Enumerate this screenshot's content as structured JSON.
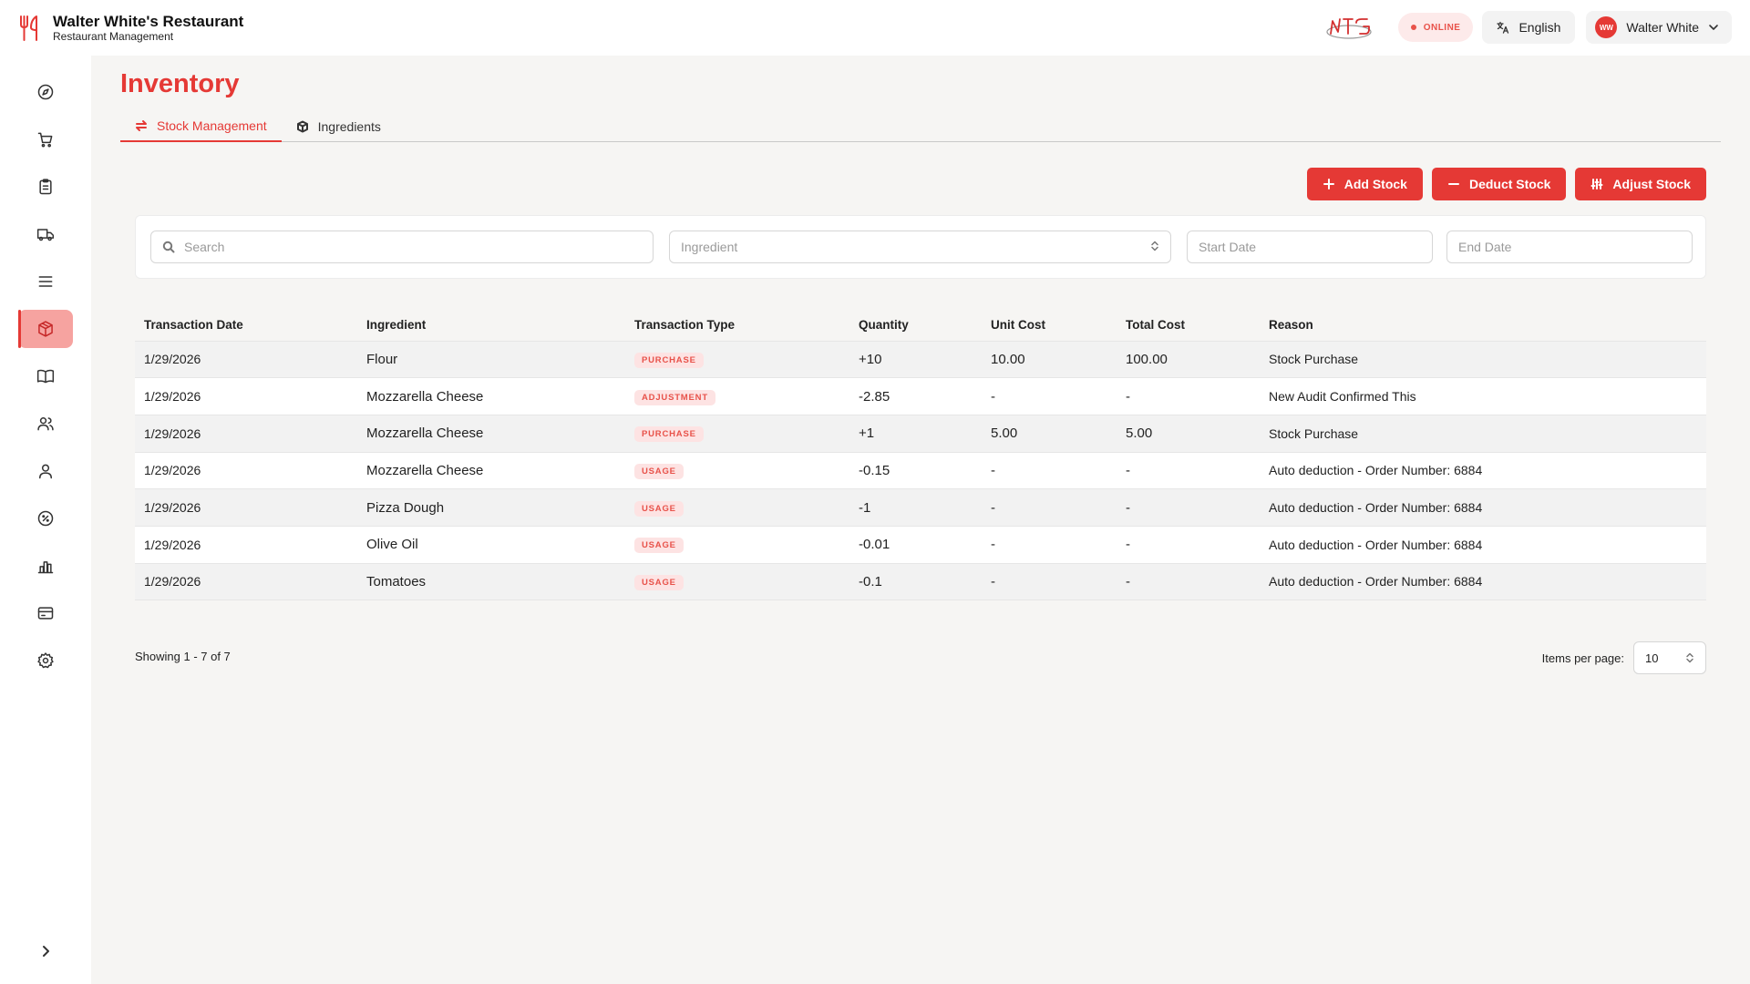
{
  "header": {
    "title": "Walter White's Restaurant",
    "subtitle": "Restaurant Management",
    "status": "ONLINE",
    "language": "English",
    "user_initials": "WW",
    "user_name": "Walter White"
  },
  "sidebar": {
    "items": [
      {
        "icon": "dashboard-icon"
      },
      {
        "icon": "cart-icon"
      },
      {
        "icon": "clipboard-icon"
      },
      {
        "icon": "truck-icon"
      },
      {
        "icon": "menu-icon"
      },
      {
        "icon": "box-icon",
        "active": true
      },
      {
        "icon": "book-icon"
      },
      {
        "icon": "users-icon"
      },
      {
        "icon": "user-icon"
      },
      {
        "icon": "discount-icon"
      },
      {
        "icon": "chart-icon"
      },
      {
        "icon": "card-icon"
      },
      {
        "icon": "gear-icon"
      }
    ]
  },
  "page": {
    "title": "Inventory",
    "tabs": [
      {
        "label": "Stock Management"
      },
      {
        "label": "Ingredients"
      }
    ],
    "actions": {
      "add": "Add Stock",
      "deduct": "Deduct Stock",
      "adjust": "Adjust Stock"
    },
    "filters": {
      "search_placeholder": "Search",
      "ingredient_placeholder": "Ingredient",
      "start_placeholder": "Start Date",
      "end_placeholder": "End Date"
    }
  },
  "table": {
    "headers": [
      "Transaction Date",
      "Ingredient",
      "Transaction Type",
      "Quantity",
      "Unit Cost",
      "Total Cost",
      "Reason"
    ],
    "rows": [
      {
        "date": "1/29/2026",
        "ingredient": "Flour",
        "type": "PURCHASE",
        "quantity": "+10",
        "unit_cost": "10.00",
        "total_cost": "100.00",
        "reason": "Stock Purchase"
      },
      {
        "date": "1/29/2026",
        "ingredient": "Mozzarella Cheese",
        "type": "ADJUSTMENT",
        "quantity": "-2.85",
        "unit_cost": "-",
        "total_cost": "-",
        "reason": "New Audit Confirmed This"
      },
      {
        "date": "1/29/2026",
        "ingredient": "Mozzarella Cheese",
        "type": "PURCHASE",
        "quantity": "+1",
        "unit_cost": "5.00",
        "total_cost": "5.00",
        "reason": "Stock Purchase"
      },
      {
        "date": "1/29/2026",
        "ingredient": "Mozzarella Cheese",
        "type": "USAGE",
        "quantity": "-0.15",
        "unit_cost": "-",
        "total_cost": "-",
        "reason": "Auto deduction - Order Number: 6884"
      },
      {
        "date": "1/29/2026",
        "ingredient": "Pizza Dough",
        "type": "USAGE",
        "quantity": "-1",
        "unit_cost": "-",
        "total_cost": "-",
        "reason": "Auto deduction - Order Number: 6884"
      },
      {
        "date": "1/29/2026",
        "ingredient": "Olive Oil",
        "type": "USAGE",
        "quantity": "-0.01",
        "unit_cost": "-",
        "total_cost": "-",
        "reason": "Auto deduction - Order Number: 6884"
      },
      {
        "date": "1/29/2026",
        "ingredient": "Tomatoes",
        "type": "USAGE",
        "quantity": "-0.1",
        "unit_cost": "-",
        "total_cost": "-",
        "reason": "Auto deduction - Order Number: 6884"
      }
    ]
  },
  "footer": {
    "showing": "Showing 1 - 7 of 7",
    "items_per_page_label": "Items per page:",
    "items_per_page": "10"
  },
  "colors": {
    "accent": "#e53935",
    "badge_bg": "#fde3e3",
    "badge_text": "#e8524a",
    "active_nav": "#f6a3a0"
  }
}
